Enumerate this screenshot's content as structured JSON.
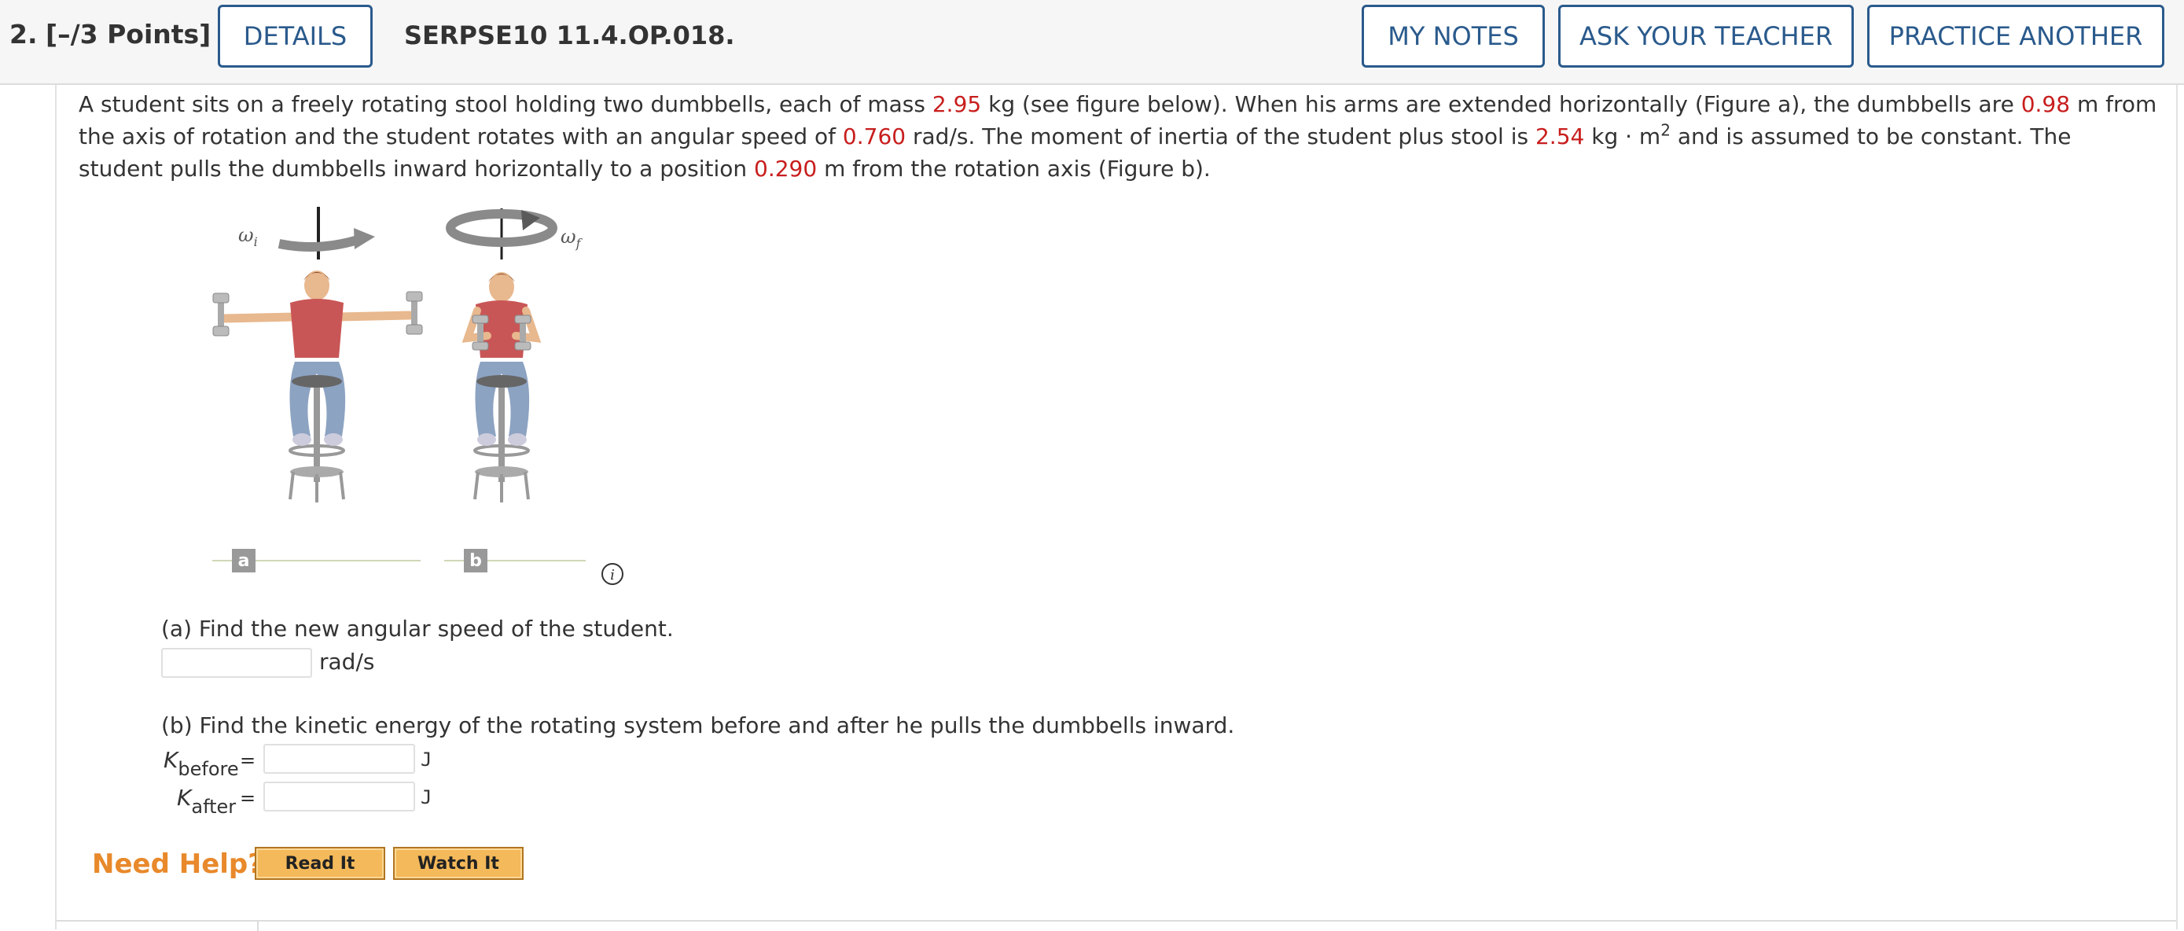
{
  "header": {
    "number": "2.",
    "points": "[–/3 Points]",
    "details_label": "DETAILS",
    "code": "SERPSE10 11.4.OP.018.",
    "my_notes_label": "MY NOTES",
    "ask_teacher_label": "ASK YOUR TEACHER",
    "practice_label": "PRACTICE ANOTHER"
  },
  "problem": {
    "t1": "A student sits on a freely rotating stool holding two dumbbells, each of mass ",
    "mass": "2.95",
    "t2": " kg (see figure below). When his arms are extended horizontally (Figure a), the dumbbells are ",
    "distance1": "0.98",
    "t3": " m from the axis of rotation and the student rotates with an angular speed of ",
    "omega": "0.760",
    "t4": " rad/s. The moment of inertia of the student plus stool is ",
    "inertia": "2.54",
    "t5": " kg · m",
    "t5sup": "2",
    "t6": " and is assumed to be constant. The student pulls the dumbbells inward horizontally to a position ",
    "distance2": "0.290",
    "t7": " m from the rotation axis (Figure b)."
  },
  "figure": {
    "omega_i": "ω",
    "omega_i_sub": "i",
    "omega_f": "ω",
    "omega_f_sub": "f",
    "label_a": "a",
    "label_b": "b",
    "info_icon": "info-icon"
  },
  "part_a": {
    "question": "(a) Find the new angular speed of the student.",
    "unit": "rad/s",
    "value": ""
  },
  "part_b": {
    "question": "(b) Find the kinetic energy of the rotating system before and after he pulls the dumbbells inward.",
    "k_symbol": "K",
    "before_sub": "before",
    "after_sub": "after",
    "equals": "=",
    "unit": "J"
  },
  "help": {
    "label": "Need Help?",
    "read_it": "Read It",
    "watch_it": "Watch It"
  },
  "colors": {
    "accent": "#2a5a8c",
    "red_value": "#c81e1e",
    "help_orange": "#e8892b",
    "button_gold": "#f4b95a"
  }
}
